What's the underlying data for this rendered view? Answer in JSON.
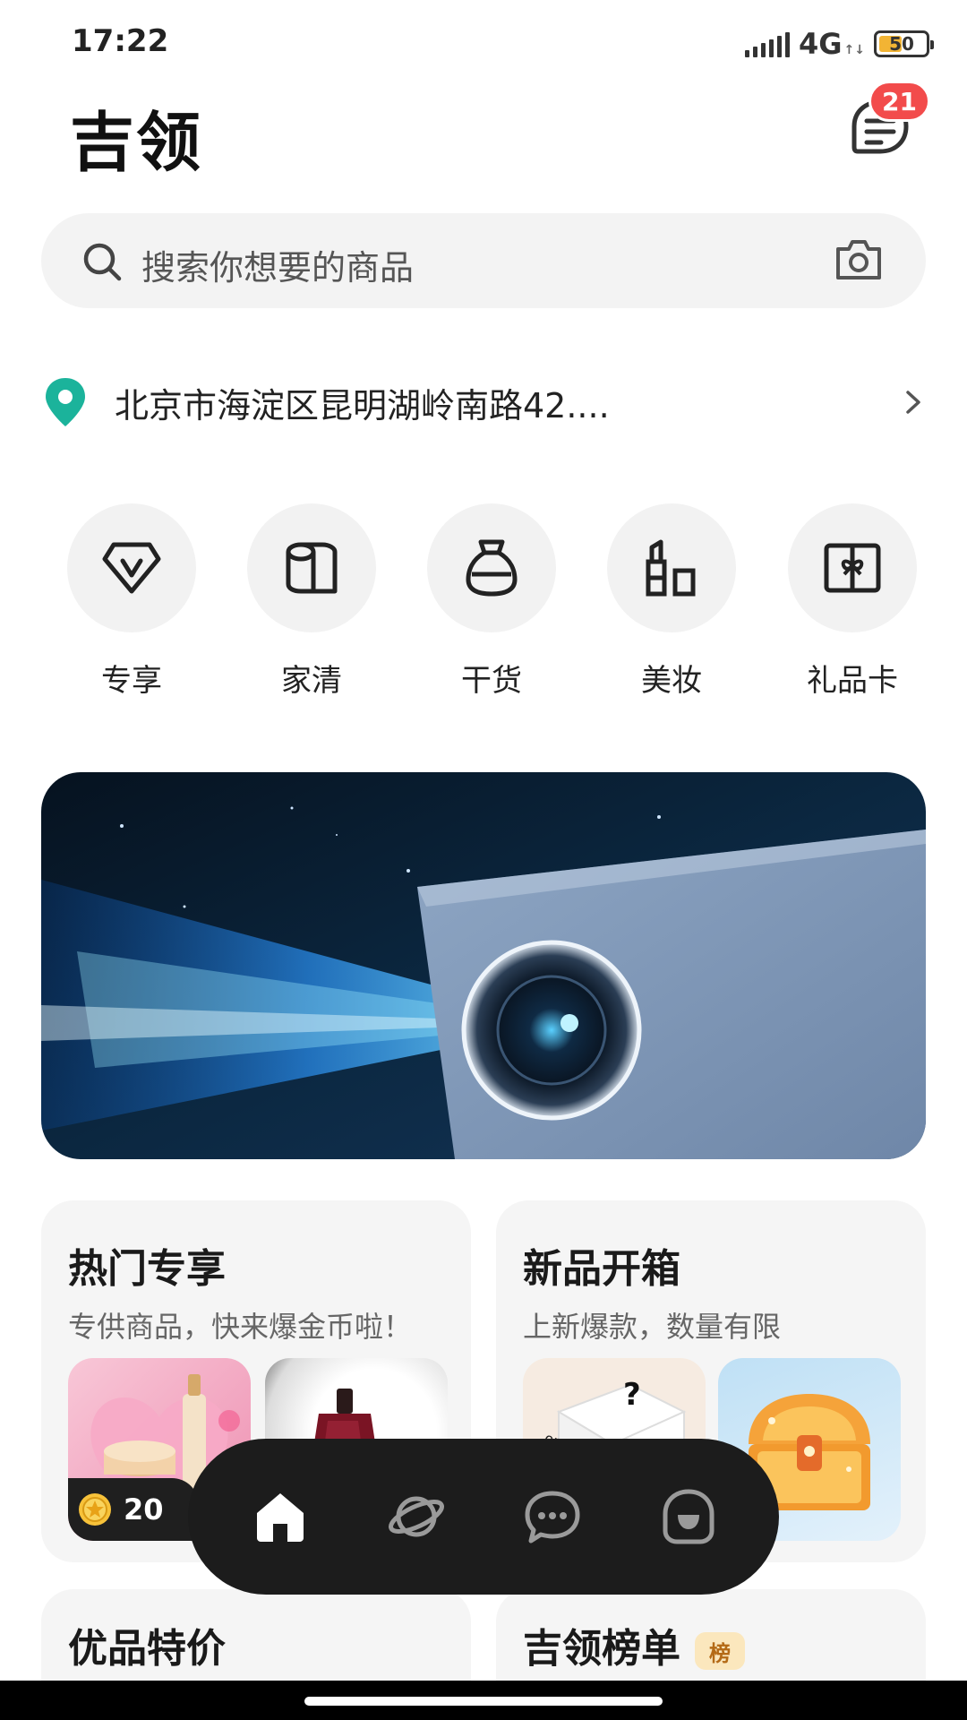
{
  "status_bar": {
    "time": "17:22",
    "network": "4G",
    "battery": "50",
    "battery_level": 0.5
  },
  "header": {
    "title": "吉领",
    "message_badge": "21"
  },
  "search": {
    "placeholder": "搜索你想要的商品"
  },
  "address": {
    "text": "北京市海淀区昆明湖岭南路42...."
  },
  "categories": [
    {
      "label": "专享",
      "icon": "diamond-v-icon"
    },
    {
      "label": "家清",
      "icon": "paper-roll-icon"
    },
    {
      "label": "干货",
      "icon": "grain-sack-icon"
    },
    {
      "label": "美妆",
      "icon": "lipstick-icon"
    },
    {
      "label": "礼品卡",
      "icon": "gift-card-icon"
    }
  ],
  "cards": {
    "hot": {
      "title": "热门专享",
      "subtitle": "专供商品，快来爆金币啦！",
      "coin_value": "20"
    },
    "new": {
      "title": "新品开箱",
      "subtitle": "上新爆款，数量有限",
      "box_text": "orange desire"
    },
    "deals": {
      "title": "优品特价"
    },
    "ranking": {
      "title": "吉领榜单",
      "badge": "榜"
    }
  },
  "bottom_nav": [
    {
      "icon": "home-icon",
      "active": true
    },
    {
      "icon": "planet-icon",
      "active": false
    },
    {
      "icon": "chat-icon",
      "active": false
    },
    {
      "icon": "profile-icon",
      "active": false
    }
  ],
  "colors": {
    "accent_teal": "#1bb39b",
    "badge_red": "#f24b4b",
    "nav_bg": "#1c1c1c"
  }
}
